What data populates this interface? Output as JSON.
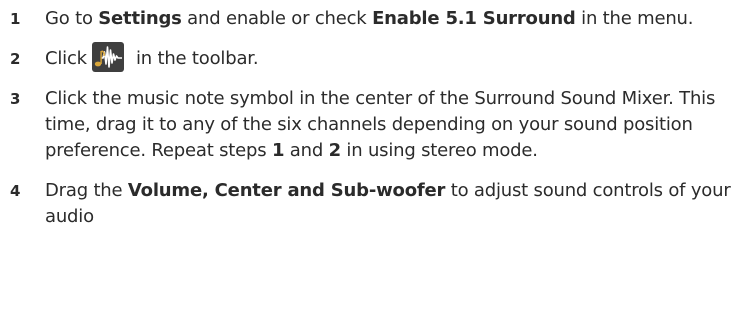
{
  "steps": [
    {
      "number": "1",
      "parts": [
        {
          "text": "Go to ",
          "bold": false
        },
        {
          "text": "Settings",
          "bold": true
        },
        {
          "text": " and enable or check ",
          "bold": false
        },
        {
          "text": "Enable 5.1 Surround",
          "bold": true
        },
        {
          "text": " in the menu.",
          "bold": false
        }
      ]
    },
    {
      "number": "2",
      "before_icon": "Click ",
      "icon": "surround-sound-mixer-icon",
      "after_icon": " in the toolbar."
    },
    {
      "number": "3",
      "parts": [
        {
          "text": "Click the music note symbol in the center of the Surround Sound Mixer. This time, drag it to any of the six channels depending on your sound position preference. Repeat steps ",
          "bold": false
        },
        {
          "text": "1",
          "bold": true
        },
        {
          "text": " and ",
          "bold": false
        },
        {
          "text": "2",
          "bold": true
        },
        {
          "text": " in using stereo mode.",
          "bold": false
        }
      ]
    },
    {
      "number": "4",
      "parts": [
        {
          "text": "Drag the ",
          "bold": false
        },
        {
          "text": "Volume, Center and Sub-woofer",
          "bold": true
        },
        {
          "text": " to adjust sound controls of your audio",
          "bold": false
        }
      ]
    }
  ],
  "colors": {
    "text": "#2b2b2b",
    "icon_background": "#3f3f3f",
    "icon_wave": "#ffffff",
    "icon_note": "#d9a63a"
  }
}
